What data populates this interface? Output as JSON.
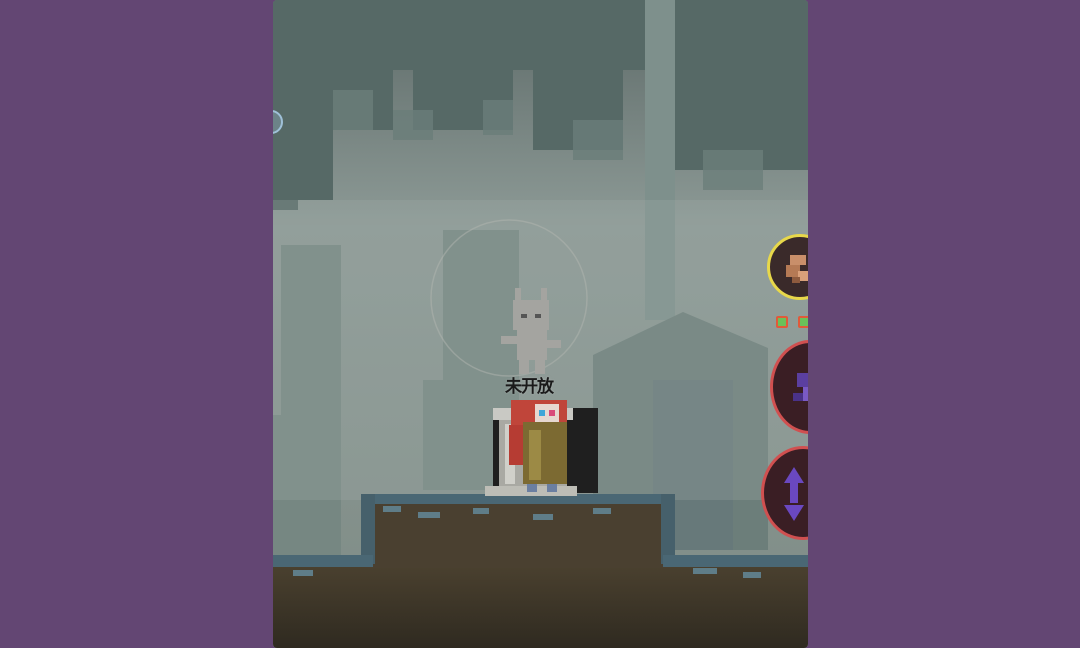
{
  "scene": {
    "statue_sign": "未开放"
  },
  "hud": {
    "buttons": [
      {
        "name": "item-button",
        "icon": "item-icon"
      },
      {
        "name": "skill-button",
        "icon": "skill-icon"
      },
      {
        "name": "jump-button",
        "icon": "up-down-arrows-icon"
      }
    ],
    "indicator_dots": 2
  },
  "colors": {
    "background": "#634673",
    "fog": "#8a9995",
    "ground": "#4a3f2b",
    "moss": "#4f6f78",
    "button_border_gold": "#e8d84a",
    "button_border_red": "#d05050"
  }
}
